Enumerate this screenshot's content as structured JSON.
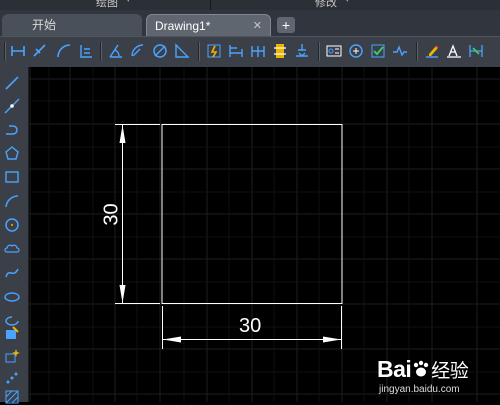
{
  "ribbon": {
    "panels": [
      "绘图",
      "修改"
    ]
  },
  "tabs": [
    {
      "label": "开始"
    },
    {
      "label": "Drawing1*"
    }
  ],
  "tab_close_glyph": "✕",
  "tab_add_glyph": "+",
  "drawing": {
    "horizontal_dimension": "30",
    "vertical_dimension": "30"
  },
  "watermark": {
    "logo": "Bai",
    "logo_cn": "经验",
    "url": "jingyan.baidu.com"
  },
  "colors": {
    "canvas": "#000000",
    "toolbar": "#3b4048",
    "accent": "#f0b400",
    "icon_blue": "#4aa3ff"
  }
}
